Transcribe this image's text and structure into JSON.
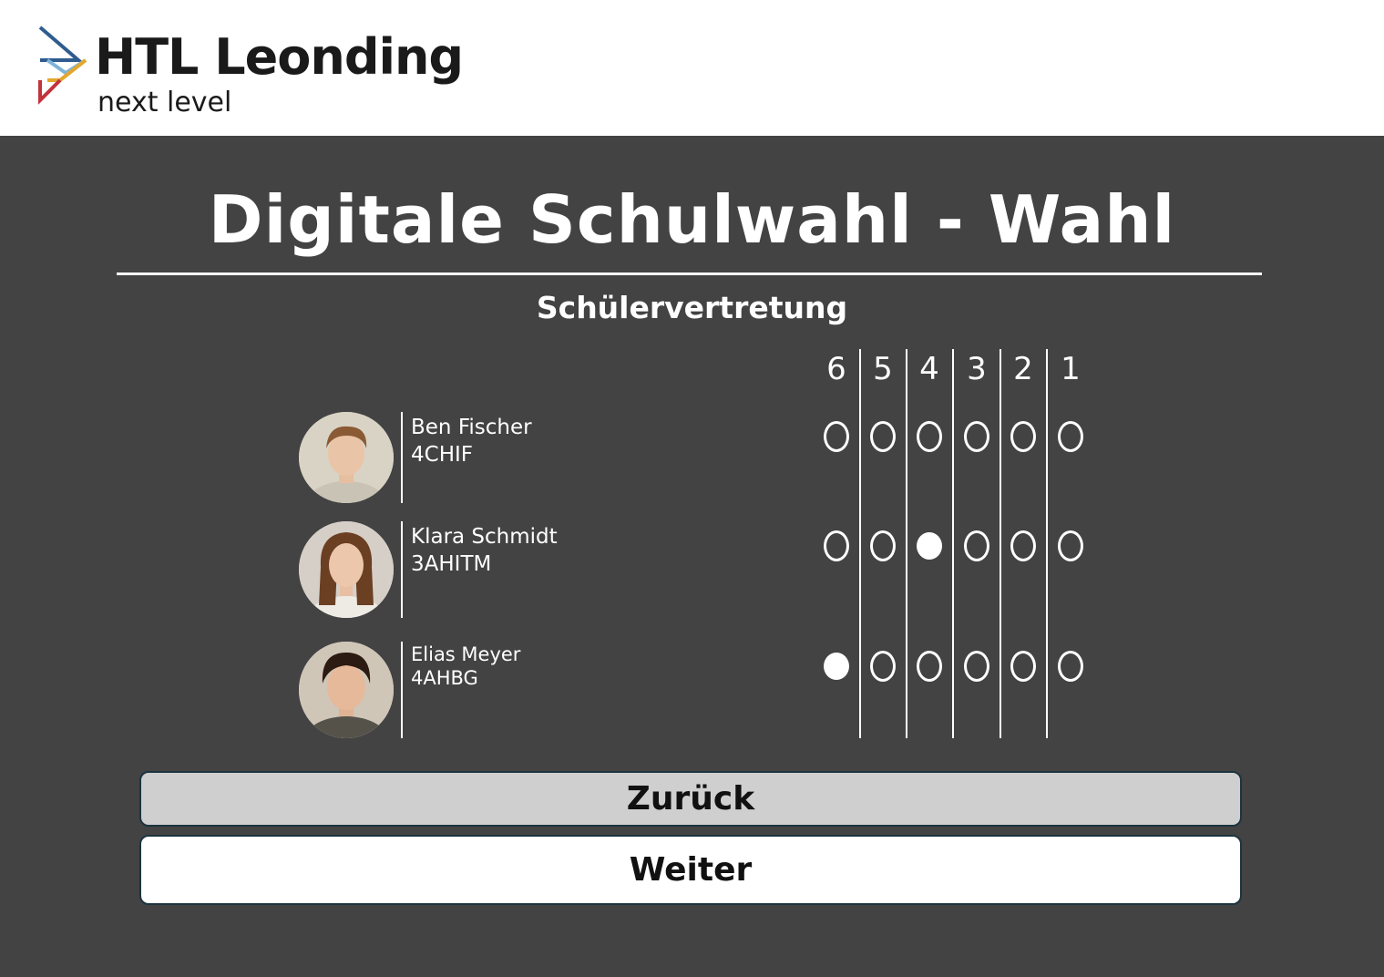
{
  "header": {
    "brand_title": "HTL Leonding",
    "brand_subtitle": "next level",
    "logo_colors": [
      "#2f5c8f",
      "#7fb3d9",
      "#e3a72f",
      "#c2343b"
    ]
  },
  "page": {
    "title": "Digitale Schulwahl - Wahl",
    "section": "Schülervertretung"
  },
  "ranks": [
    "6",
    "5",
    "4",
    "3",
    "2",
    "1"
  ],
  "candidates": [
    {
      "name": "Ben Fischer",
      "class": "4CHIF",
      "selected_rank": null
    },
    {
      "name": "Klara Schmidt",
      "class": "3AHITM",
      "selected_rank": "4"
    },
    {
      "name": "Elias Meyer",
      "class": "4AHBG",
      "selected_rank": "6"
    }
  ],
  "buttons": {
    "back": "Zurück",
    "next": "Weiter"
  },
  "colors": {
    "background": "#434343",
    "header_background": "#ffffff",
    "back_button": "#cfcfcf",
    "next_button": "#ffffff",
    "button_border": "#1d3440"
  }
}
